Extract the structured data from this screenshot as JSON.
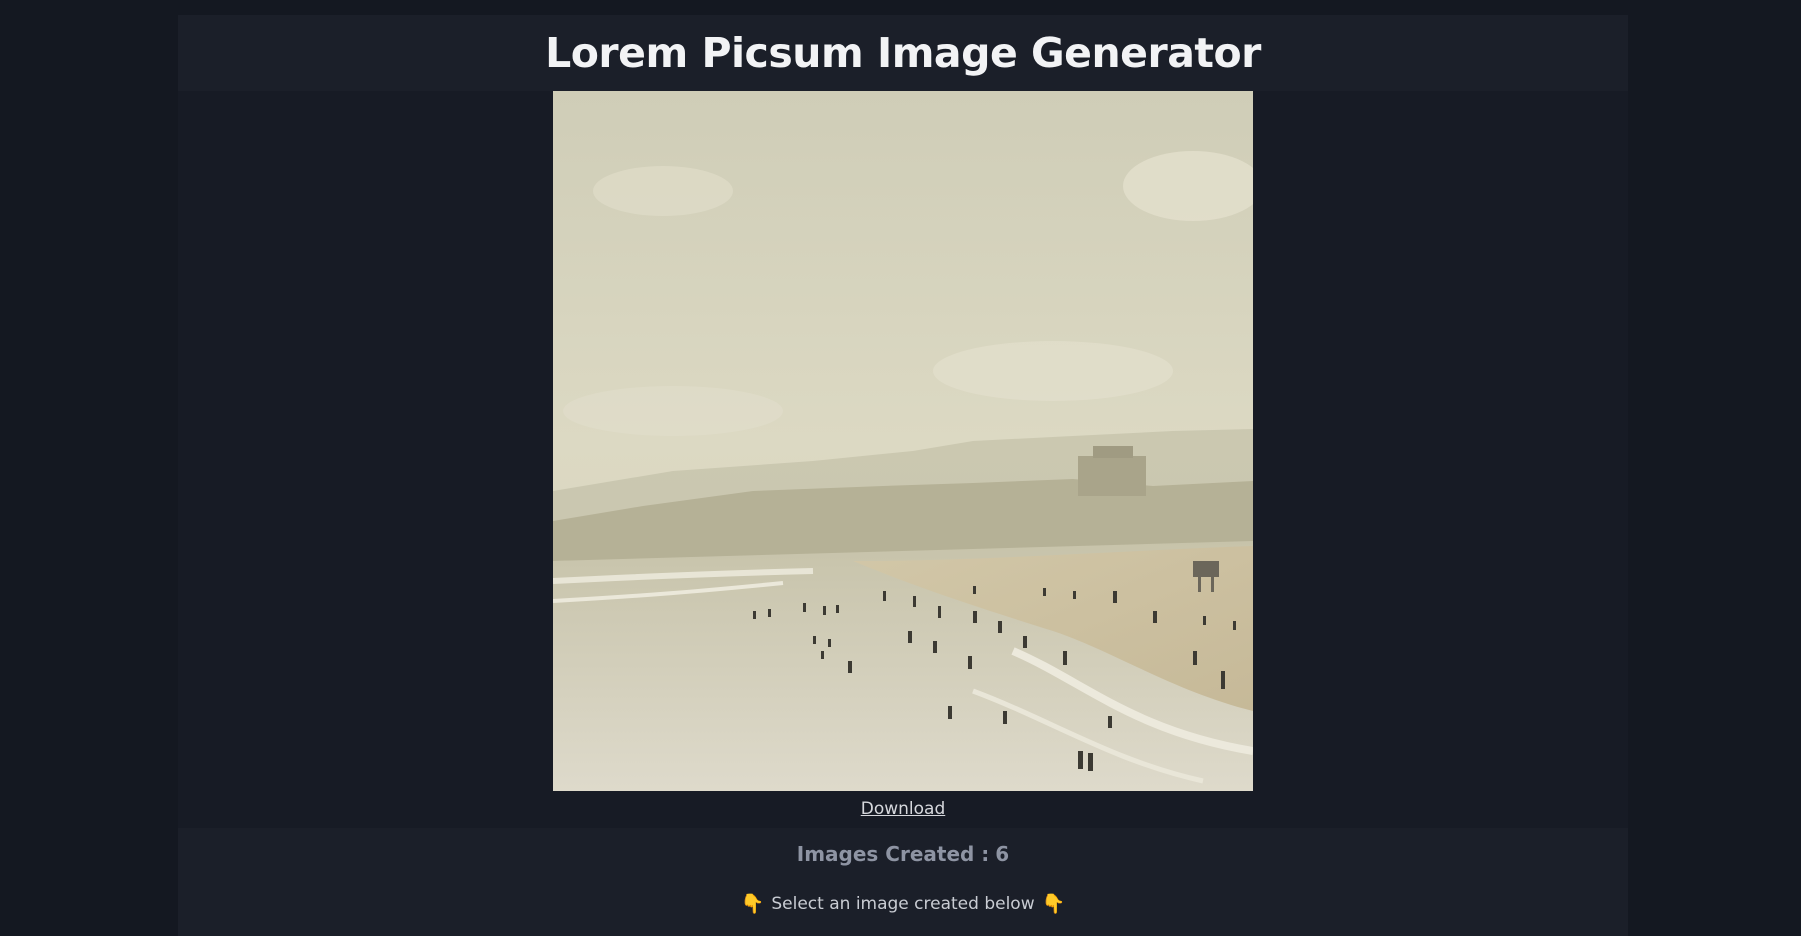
{
  "header": {
    "title": "Lorem Picsum Image Generator"
  },
  "image": {
    "alt": "beach scene",
    "icon": "photo"
  },
  "actions": {
    "download_label": "Download"
  },
  "stats": {
    "label": "Images Created :",
    "count": "6"
  },
  "hint": {
    "text": "Select an image created below",
    "icon": "pointing-down-hand"
  }
}
